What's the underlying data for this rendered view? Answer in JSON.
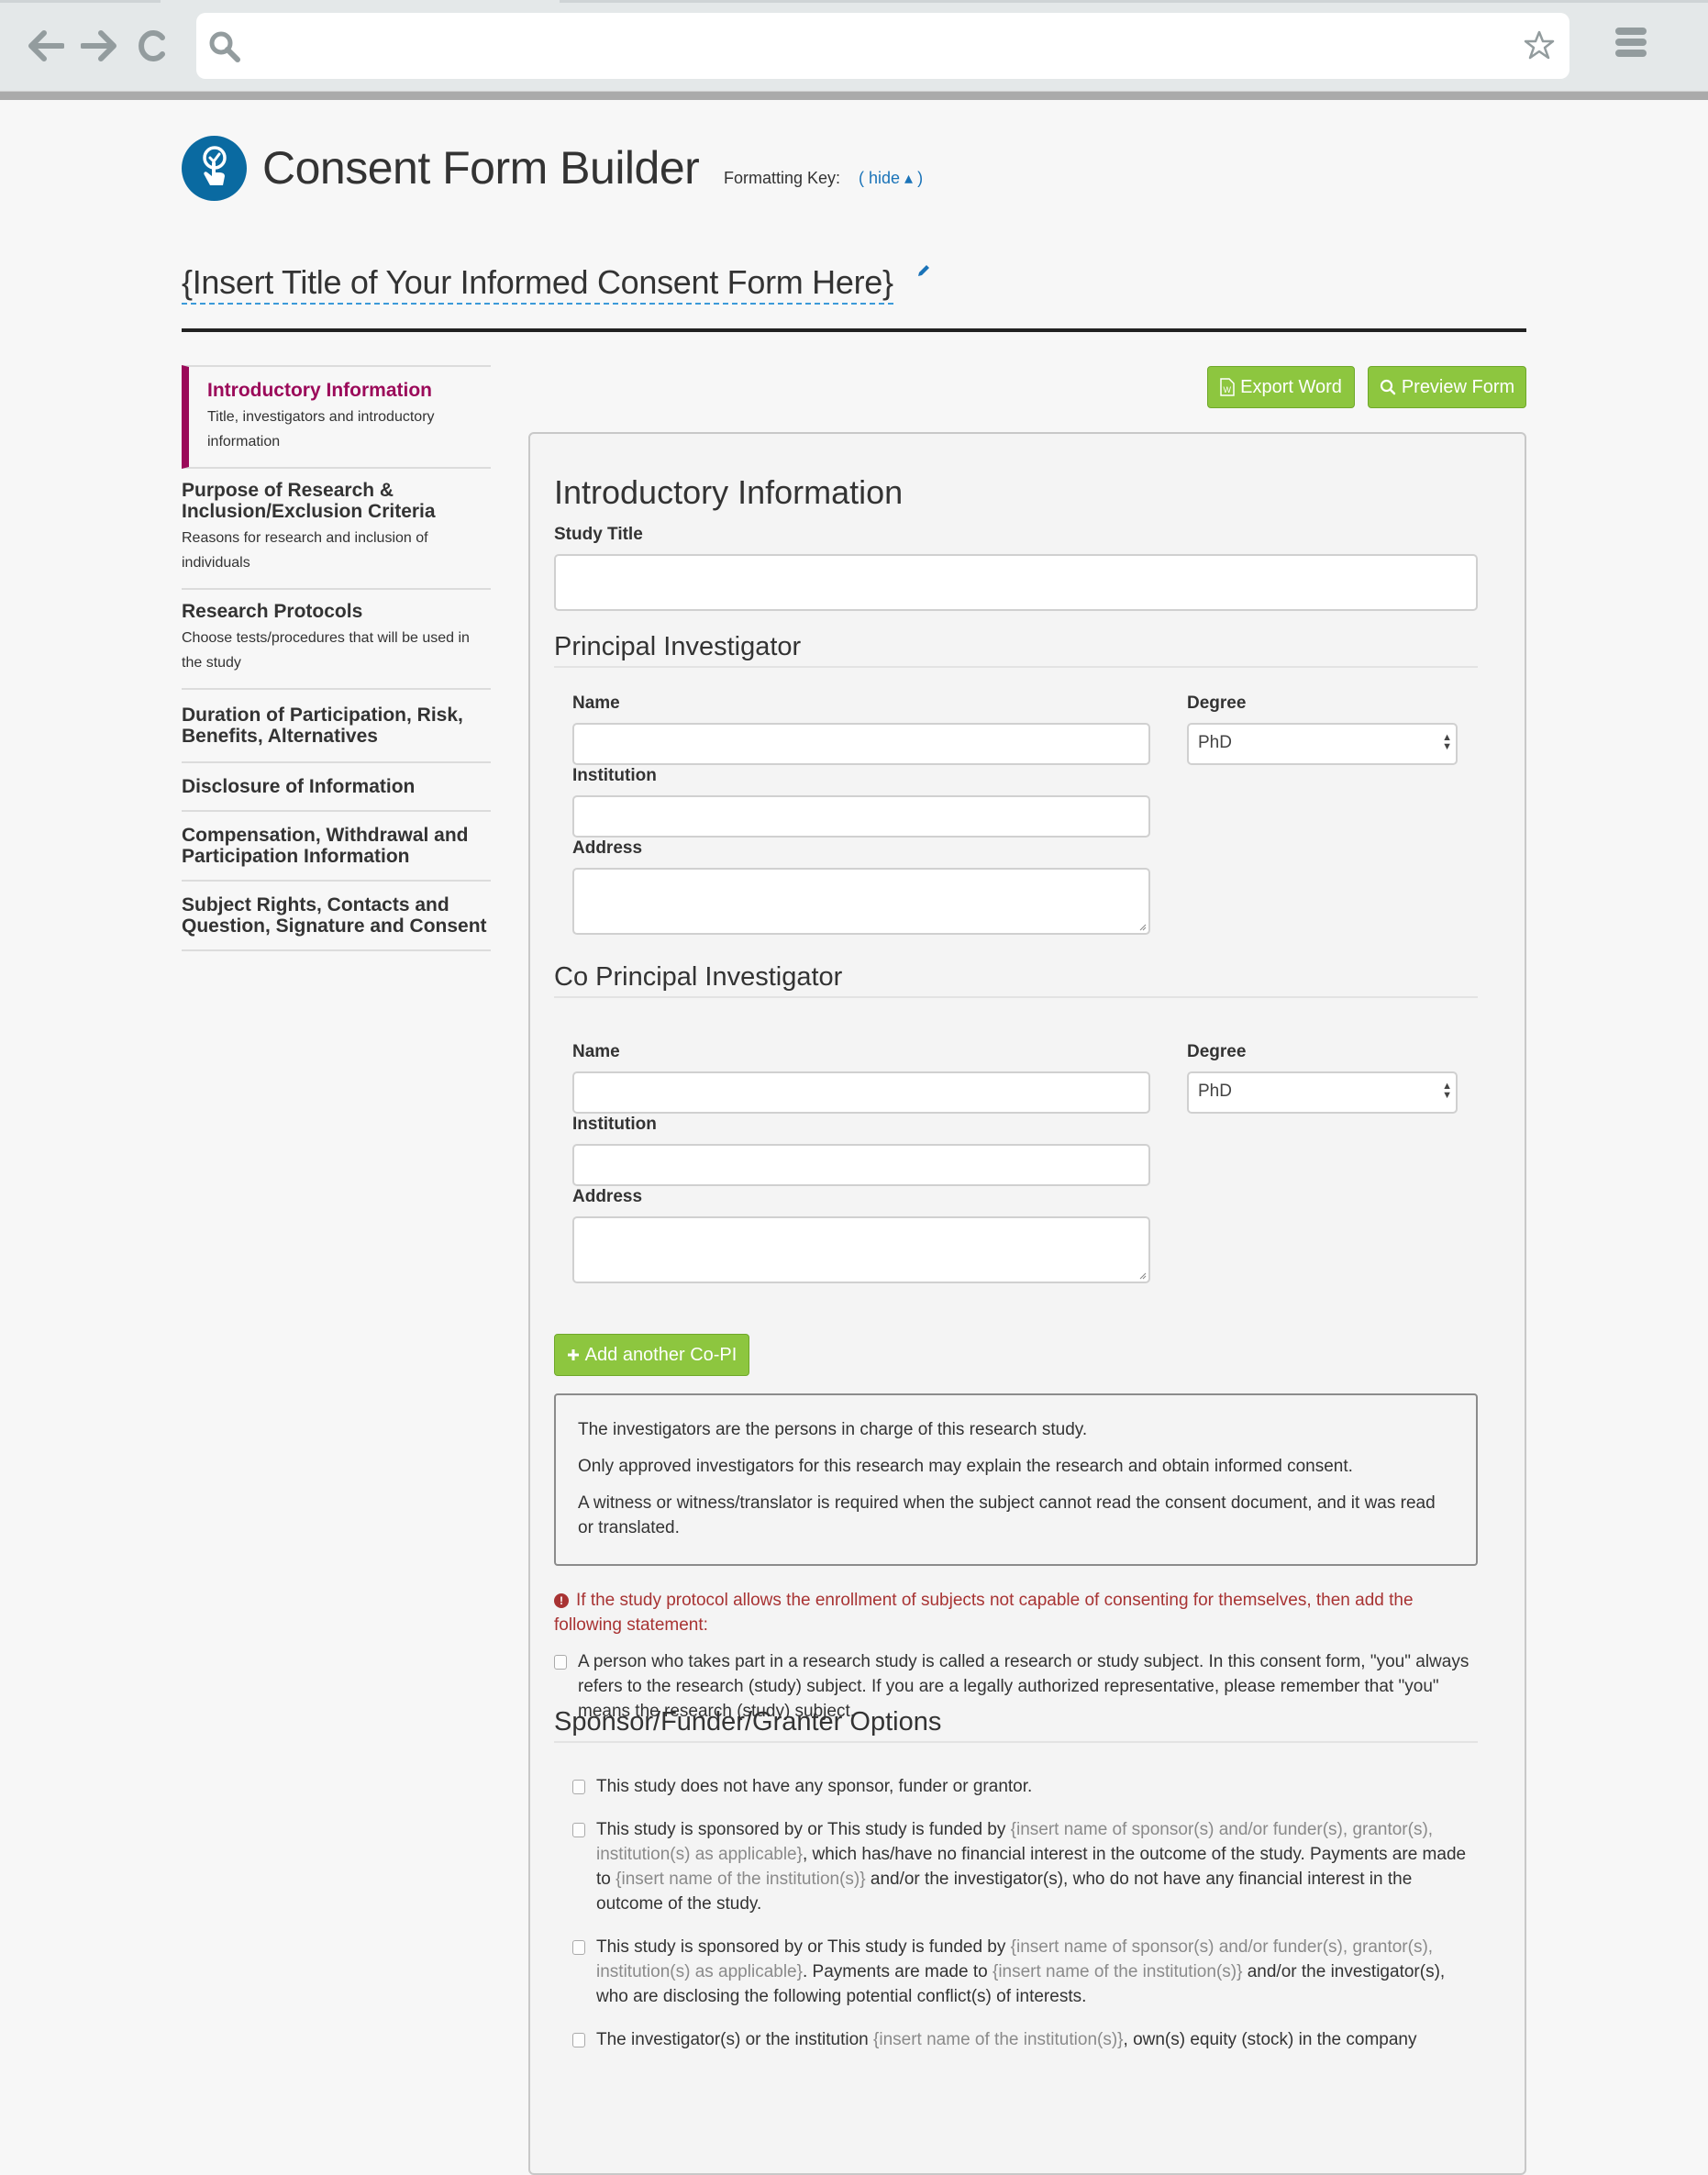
{
  "browser": {
    "url_value": "",
    "icons": {
      "back": "arrow-left-icon",
      "forward": "arrow-right-icon",
      "reload": "reload-icon",
      "search": "search-icon",
      "bookmark": "star-icon",
      "menu": "hamburger-menu-icon"
    }
  },
  "header": {
    "app_title": "Consent Form Builder",
    "formatting_key_label": "Formatting Key:",
    "formatting_key_toggle": "( hide ▴ )",
    "logo_icon": "hand-tap-check-icon"
  },
  "document": {
    "title": "{Insert Title of Your Informed Consent Form Here}",
    "edit_icon": "pencil-icon"
  },
  "sidebar": {
    "items": [
      {
        "title": "Introductory Information",
        "desc": "Title, investigators and introductory information",
        "active": true
      },
      {
        "title": "Purpose of Research & Inclusion/Exclusion Criteria",
        "desc": "Reasons for research and inclusion of individuals",
        "active": false
      },
      {
        "title": "Research Protocols",
        "desc": "Choose tests/procedures that will be used in the study",
        "active": false
      },
      {
        "title": "Duration of Participation, Risk, Benefits, Alternatives",
        "desc": "",
        "active": false
      },
      {
        "title": "Disclosure of Information",
        "desc": "",
        "active": false
      },
      {
        "title": "Compensation, Withdrawal and Participation Information",
        "desc": "",
        "active": false
      },
      {
        "title": "Subject Rights, Contacts and Question, Signature and Consent",
        "desc": "",
        "active": false
      }
    ]
  },
  "toolbar": {
    "export_label": "Export Word",
    "preview_label": "Preview Form"
  },
  "main": {
    "section_title": "Introductory Information",
    "study_title_label": "Study Title",
    "study_title_value": "",
    "pi": {
      "heading": "Principal Investigator",
      "name_label": "Name",
      "name_value": "",
      "degree_label": "Degree",
      "degree_value": "PhD",
      "institution_label": "Institution",
      "institution_value": "",
      "address_label": "Address",
      "address_value": ""
    },
    "copi": {
      "heading": "Co Principal Investigator",
      "name_label": "Name",
      "name_value": "",
      "degree_label": "Degree",
      "degree_value": "PhD",
      "institution_label": "Institution",
      "institution_value": "",
      "address_label": "Address",
      "address_value": ""
    },
    "add_copi_label": "Add another Co-PI",
    "info_box": [
      "The investigators are the persons in charge of this research study.",
      "Only approved investigators for this research may explain the research and obtain informed consent.",
      "A witness or witness/translator is required when the subject cannot read the consent document, and it was read or translated."
    ],
    "warning": "If the study protocol allows the enrollment of subjects not capable of consenting for themselves, then add the following statement:",
    "subject_statement": {
      "checked": false,
      "text": "A person who takes part in a research study is called a research or study subject. In this consent form, \"you\" always refers to the research (study) subject. If you are a legally authorized representative, please remember that \"you\" means the research (study) subject."
    },
    "sponsor": {
      "heading": "Sponsor/Funder/Granter Options",
      "options": [
        {
          "checked": false,
          "parts": [
            {
              "t": "This study does not have any sponsor, funder or grantor.",
              "ph": false
            }
          ]
        },
        {
          "checked": false,
          "parts": [
            {
              "t": "This study is sponsored by or This study is funded by ",
              "ph": false
            },
            {
              "t": "{insert name of sponsor(s) and/or funder(s), grantor(s), institution(s) as applicable}",
              "ph": true
            },
            {
              "t": ", which has/have no financial interest in the outcome of the study. Payments are made to ",
              "ph": false
            },
            {
              "t": "{insert name of the institution(s)}",
              "ph": true
            },
            {
              "t": " and/or the investigator(s), who do not have any financial interest in the outcome of the study.",
              "ph": false
            }
          ]
        },
        {
          "checked": false,
          "parts": [
            {
              "t": "This study is sponsored by or This study is funded by ",
              "ph": false
            },
            {
              "t": "{insert name of sponsor(s) and/or funder(s), grantor(s), institution(s) as applicable}",
              "ph": true
            },
            {
              "t": ". Payments are made to ",
              "ph": false
            },
            {
              "t": "{insert name of the institution(s)}",
              "ph": true
            },
            {
              "t": " and/or the investigator(s), who are disclosing the following potential conflict(s) of interests.",
              "ph": false
            }
          ]
        },
        {
          "checked": false,
          "parts": [
            {
              "t": "The investigator(s) or the institution ",
              "ph": false
            },
            {
              "t": "{insert name of the institution(s)}",
              "ph": true
            },
            {
              "t": ", own(s) equity (stock) in the company",
              "ph": false
            }
          ]
        }
      ]
    }
  },
  "colors": {
    "accent_active": "#9b0a5a",
    "button_green": "#8dc63f",
    "link_blue": "#1a73b8",
    "logo_blue": "#0a6aa1",
    "warning_red": "#a83333"
  }
}
